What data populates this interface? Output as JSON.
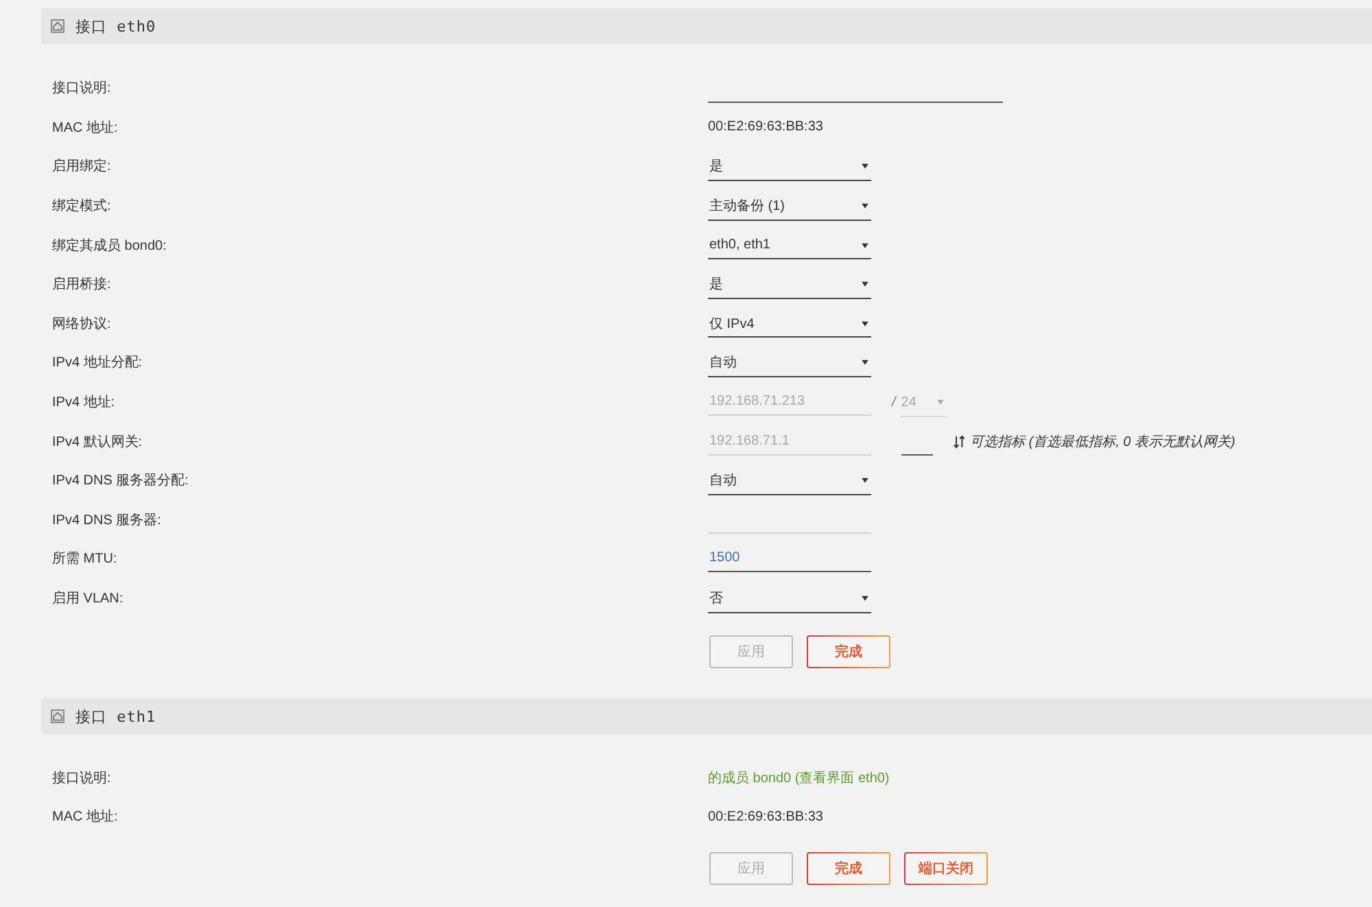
{
  "interfaces": [
    {
      "title": "接口 eth0",
      "fields": [
        {
          "kind": "wideinput",
          "label": "接口说明:",
          "disabled": false
        },
        {
          "kind": "text",
          "label": "MAC 地址:",
          "value": "00:E2:69:63:BB:33"
        },
        {
          "kind": "select",
          "label": "启用绑定:",
          "value": "是",
          "disabled": false
        },
        {
          "kind": "select",
          "label": "绑定模式:",
          "value": "主动备份 (1)",
          "disabled": false
        },
        {
          "kind": "select",
          "label": "绑定其成员 bond0:",
          "value": "eth0, eth1",
          "disabled": false
        },
        {
          "kind": "select",
          "label": "启用桥接:",
          "value": "是",
          "disabled": false
        },
        {
          "kind": "select",
          "label": "网络协议:",
          "value": "仅 IPv4",
          "disabled": false
        },
        {
          "kind": "select",
          "label": "IPv4 地址分配:",
          "value": "自动",
          "disabled": false
        },
        {
          "kind": "address",
          "label": "IPv4 地址:",
          "input": {
            "value": "192.168.71.213",
            "disabled": true
          },
          "separator": "/",
          "prefix": {
            "value": "24",
            "disabled": true
          }
        },
        {
          "kind": "gateway",
          "label": "IPv4 默认网关:",
          "input": {
            "value": "192.168.71.1",
            "disabled": true
          },
          "metric": {
            "disabled": false
          },
          "hint": "可选指标 (首选最低指标, 0 表示无默认网关)"
        },
        {
          "kind": "select",
          "label": "IPv4 DNS 服务器分配:",
          "value": "自动",
          "disabled": false
        },
        {
          "kind": "input",
          "label": "IPv4 DNS 服务器:",
          "disabled": true
        },
        {
          "kind": "input",
          "label": "所需 MTU:",
          "placeholder": "1500",
          "disabled": false
        },
        {
          "kind": "select",
          "label": "启用 VLAN:",
          "value": "否",
          "disabled": false
        }
      ],
      "buttons": [
        {
          "label": "应用",
          "disabled": true
        },
        {
          "label": "完成",
          "disabled": false
        }
      ]
    },
    {
      "title": "接口 eth1",
      "fields": [
        {
          "kind": "note",
          "label": "接口说明:",
          "value": "的成员 bond0 (查看界面 eth0)"
        },
        {
          "kind": "text",
          "label": "MAC 地址:",
          "value": "00:E2:69:63:BB:33"
        }
      ],
      "buttons": [
        {
          "label": "应用",
          "disabled": true
        },
        {
          "label": "完成",
          "disabled": false
        },
        {
          "label": "端口关闭",
          "disabled": false
        }
      ]
    }
  ]
}
